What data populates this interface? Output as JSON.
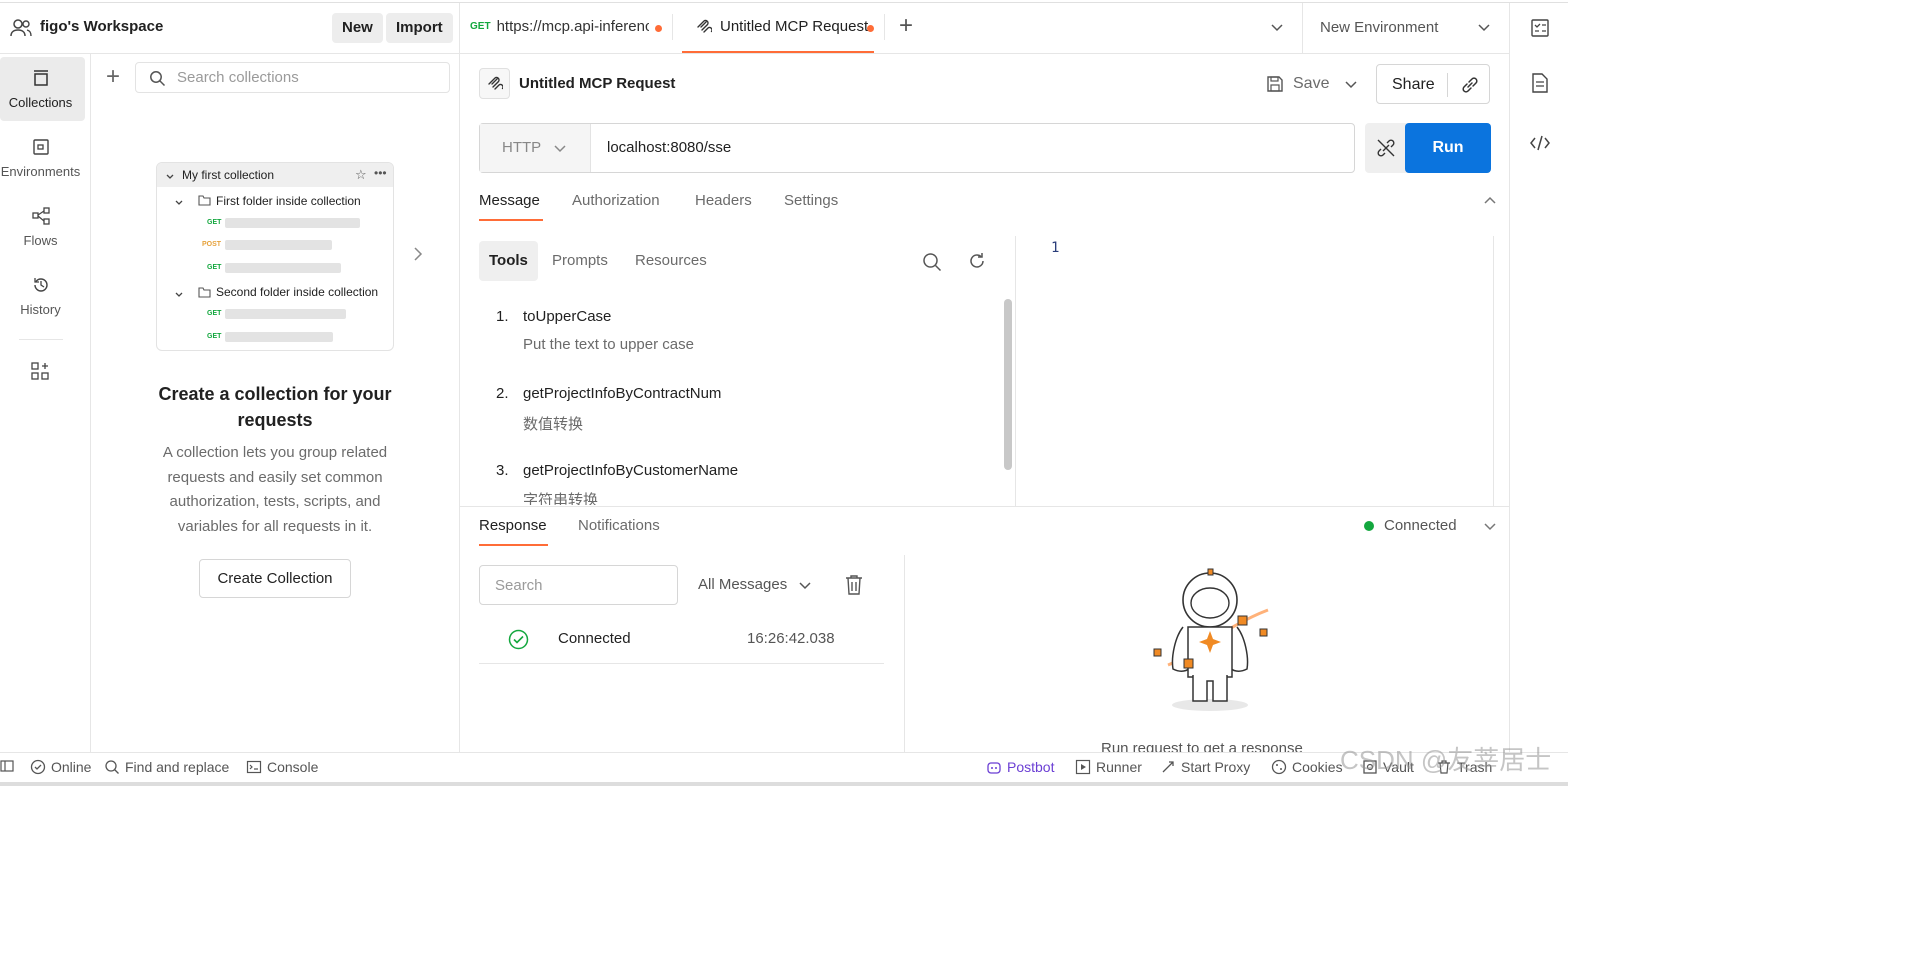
{
  "workspace": {
    "name": "figo's Workspace",
    "new_label": "New",
    "import_label": "Import"
  },
  "tabs": [
    {
      "method": "GET",
      "label": "https://mcp.api-inferenc"
    },
    {
      "label": "Untitled MCP Request"
    }
  ],
  "environment": {
    "label": "New Environment"
  },
  "sidebar": {
    "items": [
      {
        "label": "Collections",
        "icon": "collections-icon"
      },
      {
        "label": "Environments",
        "icon": "environments-icon"
      },
      {
        "label": "Flows",
        "icon": "flows-icon"
      },
      {
        "label": "History",
        "icon": "history-icon"
      }
    ],
    "search_placeholder": "Search collections"
  },
  "collection_preview": {
    "title": "My first collection",
    "folder1": "First folder inside collection",
    "folder2": "Second folder inside collection",
    "methods": [
      "GET",
      "POST",
      "GET",
      "GET",
      "GET"
    ]
  },
  "empty_state": {
    "heading": "Create a collection for your requests",
    "body": "A collection lets you group related requests and easily set common authorization, tests, scripts, and variables for all requests in it.",
    "button": "Create Collection"
  },
  "request": {
    "title": "Untitled MCP Request",
    "save_label": "Save",
    "share_label": "Share",
    "transport": "HTTP",
    "url": "localhost:8080/sse",
    "run_label": "Run"
  },
  "request_tabs": [
    "Message",
    "Authorization",
    "Headers",
    "Settings"
  ],
  "message_tabs": [
    "Tools",
    "Prompts",
    "Resources"
  ],
  "tools": [
    {
      "num": "1.",
      "name": "toUpperCase",
      "desc": "Put the text to upper case"
    },
    {
      "num": "2.",
      "name": "getProjectInfoByContractNum",
      "desc": "数值转换"
    },
    {
      "num": "3.",
      "name": "getProjectInfoByCustomerName",
      "desc": "字符串转换"
    }
  ],
  "editor": {
    "line_number": "1"
  },
  "response": {
    "tabs": [
      "Response",
      "Notifications"
    ],
    "status": "Connected",
    "search_placeholder": "Search",
    "filter": "All Messages",
    "messages": [
      {
        "text": "Connected",
        "time": "16:26:42.038"
      }
    ],
    "empty_text": "Run request to get a response"
  },
  "statusbar": {
    "online": "Online",
    "find_replace": "Find and replace",
    "console": "Console",
    "postbot": "Postbot",
    "runner": "Runner",
    "start_proxy": "Start Proxy",
    "cookies": "Cookies",
    "vault": "Vault",
    "trash": "Trash"
  },
  "watermark": "CSDN @友莘居士",
  "colors": {
    "accent": "#ff6c37",
    "run_button": "#0b74de",
    "connected": "#13a73e",
    "postbot": "#6b3fd4"
  }
}
